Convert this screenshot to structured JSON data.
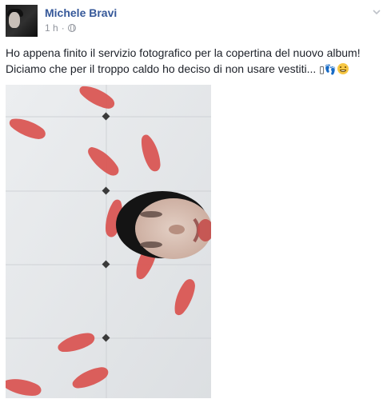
{
  "post": {
    "author": "Michele Bravi",
    "timestamp": "1 h",
    "separator": "·",
    "privacy_icon": "globe-icon",
    "options_icon": "chevron-down-icon",
    "text_line_1": "Ho appena finito il servizio fotografico per la copertina del nuovo album!",
    "text_line_2": "Diciamo che per il troppo caldo ho deciso di non usare vestiti... ",
    "emoji_box": "▯",
    "emoji_feet": "👣",
    "emoji_grin": "grinning-face-icon",
    "photo": {
      "subject": "photo-album-cover",
      "colors": {
        "tile": "#e4e6e8",
        "grout": "#c9ccd0",
        "footprint": "#d9534f",
        "hair": "#1a1a1a",
        "skin": "#d8c2b6"
      }
    }
  }
}
